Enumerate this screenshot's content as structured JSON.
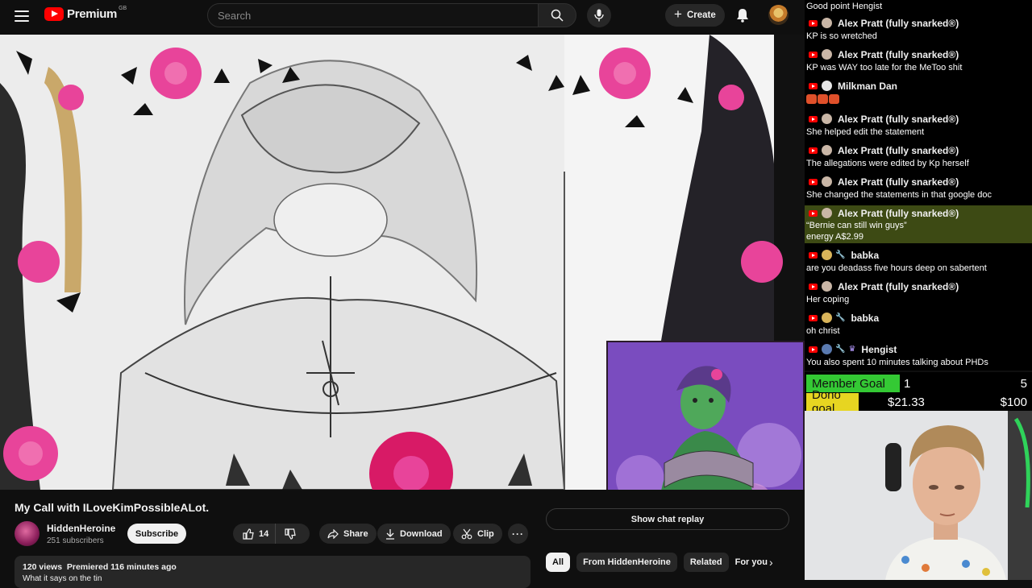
{
  "header": {
    "logo_text": "Premium",
    "logo_country": "GB",
    "search_placeholder": "Search",
    "create_label": "Create"
  },
  "video": {
    "title": "My Call with ILoveKimPossibleALot.",
    "channel_name": "HiddenHeroine",
    "subscribers": "251 subscribers",
    "subscribe_label": "Subscribe",
    "like_count": "14",
    "share_label": "Share",
    "download_label": "Download",
    "clip_label": "Clip",
    "more_label": "···",
    "views_line": "120 views  Premiered 116 minutes ago",
    "description_snippet": "What it says on the tin"
  },
  "side": {
    "show_chat_replay": "Show chat replay",
    "chips": [
      "All",
      "From HiddenHeroine",
      "Related",
      "For you"
    ],
    "active_chip": "All"
  },
  "chat": {
    "messages": [
      {
        "author": "",
        "text": "Good point Hengist"
      },
      {
        "author": "Alex Pratt (fully snarked®)",
        "text": "KP is so wretched"
      },
      {
        "author": "Alex Pratt (fully snarked®)",
        "text": "KP was WAY too late for the MeToo shit"
      },
      {
        "author": "Milkman Dan",
        "text": ""
      },
      {
        "author": "Alex Pratt (fully snarked®)",
        "text": "She helped edit the statement"
      },
      {
        "author": "Alex Pratt (fully snarked®)",
        "text": "The allegations were edited by Kp herself"
      },
      {
        "author": "Alex Pratt (fully snarked®)",
        "text": "She changed the statements in that google doc"
      },
      {
        "author": "Alex Pratt (fully snarked®)",
        "text": "“Bernie can still win guys”",
        "text2": "energy",
        "amount": "A$2.99"
      },
      {
        "author": "babka",
        "text": "are you deadass five hours deep on sabertent"
      },
      {
        "author": "Alex Pratt (fully snarked®)",
        "text": "Her coping"
      },
      {
        "author": "babka",
        "text": "oh christ"
      },
      {
        "author": "Hengist",
        "text": "You also spent 10 minutes talking about PHDs"
      }
    ]
  },
  "goals": {
    "member": {
      "label": "Member Goal",
      "current": "1",
      "target": "5"
    },
    "dono": {
      "label": "Dono goal",
      "current": "$21.33",
      "target": "$100"
    }
  },
  "colors": {
    "brand_red": "#ff0000",
    "member_green": "#34c934",
    "dono_yellow": "#e7d521",
    "superchat_bg": "#3d4a14"
  }
}
